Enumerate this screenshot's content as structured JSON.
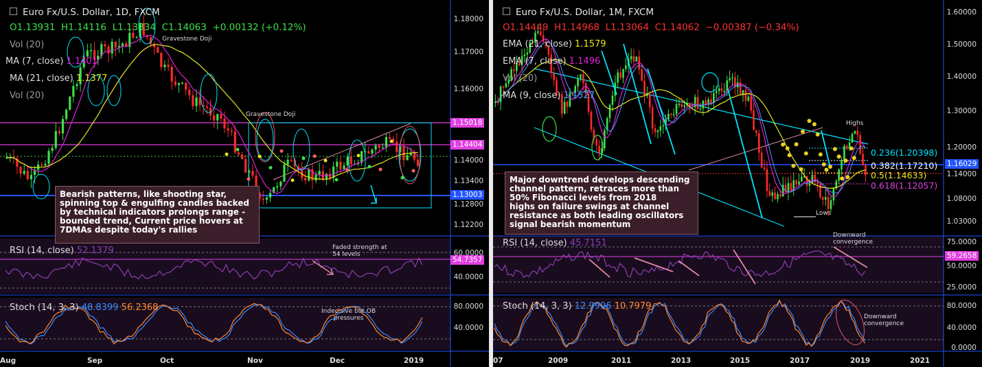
{
  "left": {
    "title": "Euro Fx/U.S. Dollar, 1D, FXCM",
    "ohlc": {
      "o": "O1.13931",
      "h": "H1.14116",
      "l": "L1.13834",
      "c": "C1.14063",
      "chg": "+0.00132 (+0.12%)"
    },
    "indicators": {
      "vol": "Vol (20)",
      "ma7": "MA (7, close)",
      "ma7_val": "1.1401",
      "ma21": "MA (21, close)",
      "ma21_val": "1.1377",
      "vol2": "Vol (20)"
    },
    "annotations": {
      "doji1": "Gravestone Doji",
      "doji2": "Gravestone Doji",
      "faded": "Faded strength at\n54 levels",
      "stoch_note": "Indecisive but OB\npressures"
    },
    "callout": "Bearish patterns, like shooting star,\nspinning top & engulfing candles backed\nby technical indicators prolongs range -\nbounded trend, Current price hovers at\n7DMAs despite today's rallies",
    "price_axis": [
      "1.18000",
      "1.17000",
      "1.16000",
      "1.14000",
      "1.13400",
      "1.12800",
      "1.12200"
    ],
    "tags": {
      "t1": "1.15018",
      "t2": "1.14404",
      "t3": "1.13003"
    },
    "rsi": {
      "label": "RSI (14, close)",
      "value": "52.1379",
      "tag": "54.7357",
      "axis": [
        "60.0000",
        "40.0000"
      ]
    },
    "stoch": {
      "label": "Stoch (14, 3, 3)",
      "k": "48.8399",
      "d": "56.2368",
      "axis": [
        "80.0000",
        "40.0000"
      ]
    },
    "x_axis": [
      "Aug",
      "Sep",
      "Oct",
      "Nov",
      "Dec",
      "2019"
    ]
  },
  "right": {
    "title": "Euro Fx/U.S. Dollar, 1M, FXCM",
    "ohlc": {
      "o": "O1.14449",
      "h": "H1.14968",
      "l": "L1.13064",
      "c": "C1.14062",
      "chg": "−0.00387 (−0.34%)"
    },
    "indicators": {
      "ema21": "EMA (21, close)",
      "ema21_val": "1.1579",
      "ema7": "EMA (7, close)",
      "ema7_val": "1.1496",
      "vol": "Vol (20)",
      "ma9": "MA (9, close)",
      "ma9_val": "1.1527"
    },
    "annotations": {
      "highs": "Highs",
      "lows": "Lows",
      "downconv1": "Downward\nconvergence",
      "downconv2": "Downward\nconvergence"
    },
    "callout": "Major downtrend develops descending\nchannel pattern, retraces more than\n50% Fibonacci levels from 2018\nhighs on failure swings at channel\nresistance as both leading oscillators\nsignal bearish momentum",
    "fib": {
      "f236": "0.236(1.20398)",
      "f382": "0.382(1.17210)",
      "f5": "0.5(1.14633)",
      "f618": "0.618(1.12057)"
    },
    "price_axis": [
      "1.60000",
      "1.50000",
      "1.40000",
      "1.30000",
      "1.20000",
      "1.14000",
      "1.08000",
      "1.03000"
    ],
    "tag": "1.16029",
    "rsi": {
      "label": "RSI (14, close)",
      "value": "45.7151",
      "tag": "59.2658",
      "axis": [
        "75.0000",
        "50.0000",
        "25.0000"
      ]
    },
    "stoch": {
      "label": "Stoch (14, 3, 3)",
      "k": "12.9996",
      "d": "10.7979",
      "axis": [
        "80.0000",
        "40.0000",
        "0.0000"
      ]
    },
    "x_axis": [
      "07",
      "2009",
      "2011",
      "2013",
      "2015",
      "2017",
      "2019",
      "2021"
    ]
  },
  "colors": {
    "up": "#3ee04a",
    "down": "#ff2a2a",
    "ma_pink": "#e020e0",
    "ma_yellow": "#e8e820",
    "cyan": "#00e5ff",
    "blue": "#2255ff",
    "magenta": "#e040e0"
  }
}
